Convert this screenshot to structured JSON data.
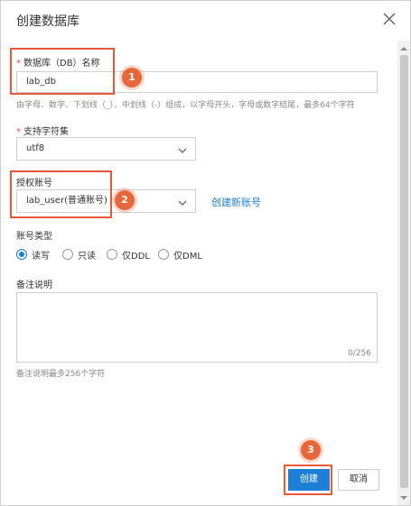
{
  "dialog": {
    "title": "创建数据库"
  },
  "db_name": {
    "required_mark": "*",
    "label": "数据库（DB）名称",
    "value": "lab_db",
    "hint": "由字母、数字、下划线（_）、中划线（-）组成，以字母开头，字母或数字结尾，最多64个字符"
  },
  "charset": {
    "required_mark": "*",
    "label": "支持字符集",
    "selected": "utf8"
  },
  "auth_account": {
    "label": "授权账号",
    "selected": "lab_user(普通账号)",
    "create_link": "创建新账号"
  },
  "account_type": {
    "label": "账号类型",
    "options": [
      "读写",
      "只读",
      "仅DDL",
      "仅DML"
    ],
    "selected_index": 0
  },
  "remark": {
    "label": "备注说明",
    "value": "",
    "counter": "0/256",
    "hint": "备注说明最多256个字符"
  },
  "footer": {
    "create_label": "创建",
    "cancel_label": "取消"
  },
  "annotations": [
    "1",
    "2",
    "3"
  ],
  "colors": {
    "accent": "#1e7fd6",
    "annotation": "#e8593a",
    "required": "#e34c3e"
  },
  "icons": {
    "close": "close-icon",
    "select_arrow": "chevron-down-icon"
  }
}
